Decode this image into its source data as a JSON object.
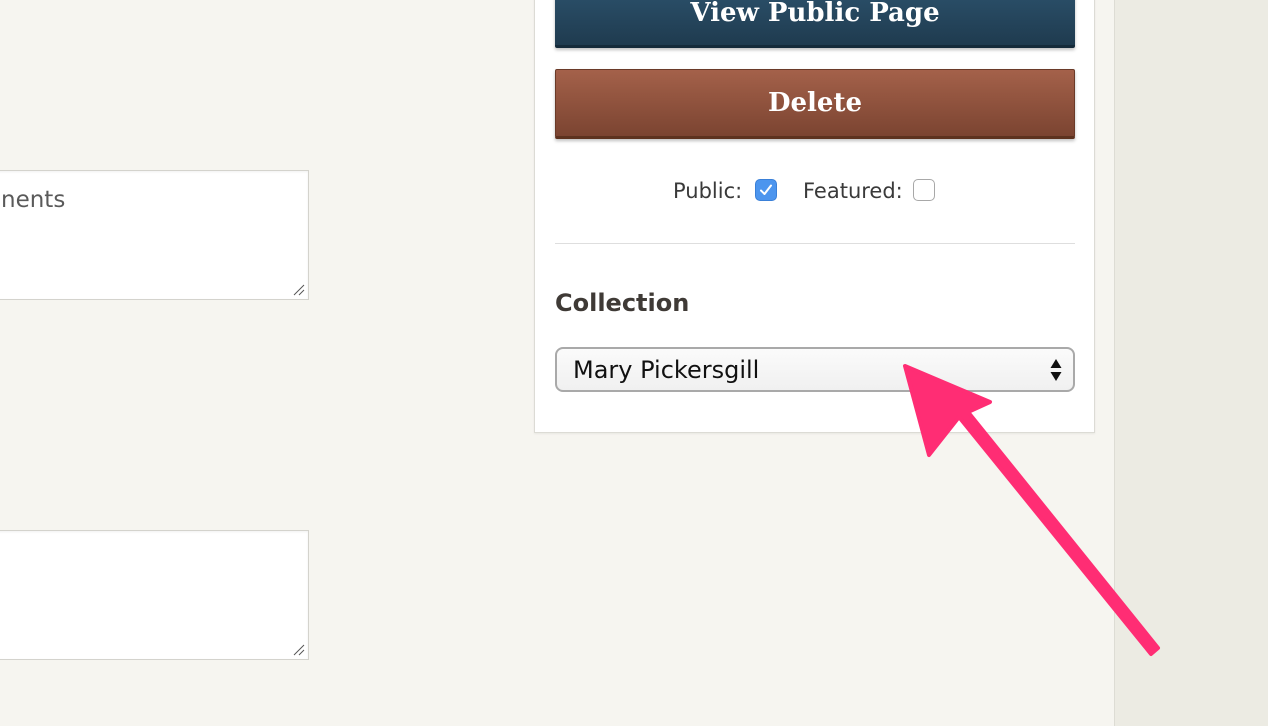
{
  "editor": {
    "textarea_1_text": "nents",
    "textarea_2_text": ""
  },
  "sidebar": {
    "view_public_page_label": "View Public Page",
    "delete_label": "Delete",
    "public_label": "Public:",
    "public_checked": true,
    "featured_label": "Featured:",
    "featured_checked": false,
    "collection_label": "Collection",
    "collection_selected": "Mary Pickersgill"
  },
  "colors": {
    "view_button": "#244559",
    "delete_button": "#8e5039",
    "checkbox_checked": "#4c95ee",
    "annotation_arrow": "#ff2d74"
  },
  "icons": {
    "checkbox_checked": "check-icon",
    "select_arrows": "updown-arrows-icon",
    "annotation": "arrow-icon"
  }
}
